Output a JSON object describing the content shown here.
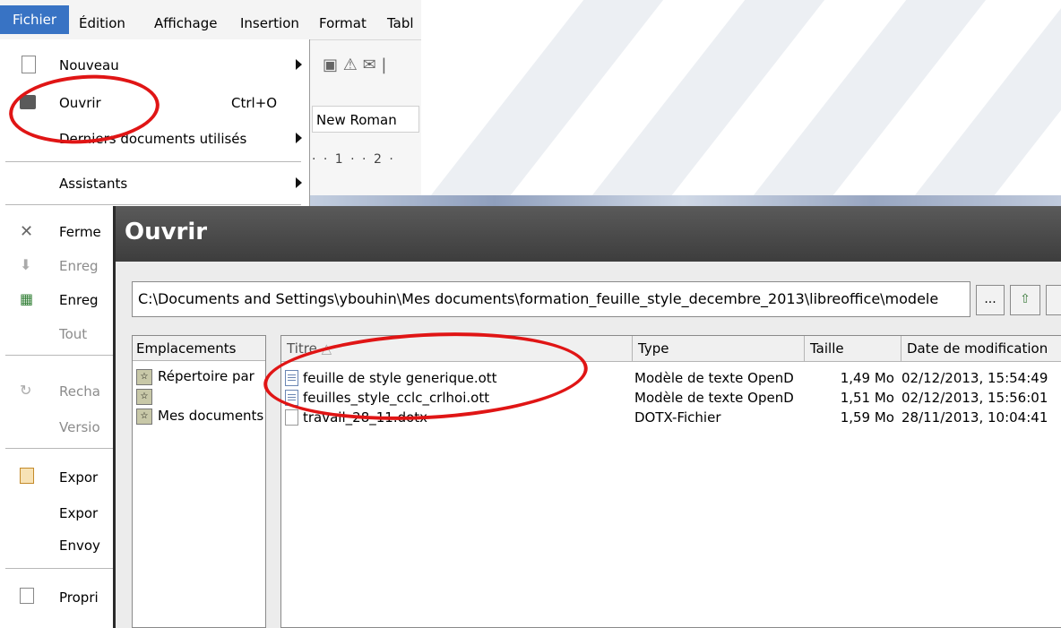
{
  "menubar": {
    "items": [
      "Fichier",
      "Édition",
      "Affichage",
      "Insertion",
      "Format",
      "Tabl"
    ]
  },
  "file_menu": {
    "items": [
      {
        "label": "Nouveau",
        "submenu": true
      },
      {
        "label": "Ouvrir",
        "shortcut": "Ctrl+O"
      },
      {
        "label": "Derniers documents utilisés",
        "submenu": true
      },
      {
        "label": "Assistants",
        "submenu": true
      },
      {
        "label": "Ferme",
        "icon": "close-x-icon"
      },
      {
        "label": "Enreg",
        "disabled": true
      },
      {
        "label": "Enreg"
      },
      {
        "label": "Tout",
        "disabled": true
      },
      {
        "label": "Recha",
        "disabled": true
      },
      {
        "label": "Versio",
        "disabled": true
      },
      {
        "label": "Expor"
      },
      {
        "label": "Expor"
      },
      {
        "label": "Envoy"
      },
      {
        "label": "Propri"
      }
    ]
  },
  "background": {
    "font_name": "New Roman",
    "ruler": "· · 1 · · 2 ·"
  },
  "dialog": {
    "title": "Ouvrir",
    "path": "C:\\Documents and Settings\\ybouhin\\Mes documents\\formation_feuille_style_decembre_2013\\libreoffice\\modele",
    "browse_button": "...",
    "places": {
      "header": "Emplacements",
      "items": [
        "Répertoire par",
        "",
        "Mes documents"
      ]
    },
    "columns": {
      "title": "Titre",
      "type": "Type",
      "size": "Taille",
      "date": "Date de modification"
    },
    "files": [
      {
        "name": "feuille de style generique.ott",
        "type": "Modèle de texte OpenD",
        "size": "1,49 Mo",
        "date": "02/12/2013, 15:54:49"
      },
      {
        "name": "feuilles_style_cclc_crlhoi.ott",
        "type": "Modèle de texte OpenD",
        "size": "1,51 Mo",
        "date": "02/12/2013, 15:56:01"
      },
      {
        "name": "travail_28_11.dotx",
        "type": "DOTX-Fichier",
        "size": "1,59 Mo",
        "date": "28/11/2013, 10:04:41"
      }
    ]
  },
  "colors": {
    "accent": "#3873c4",
    "annotation": "#e01515",
    "dialog_title_bg": "#4a4a4a"
  }
}
